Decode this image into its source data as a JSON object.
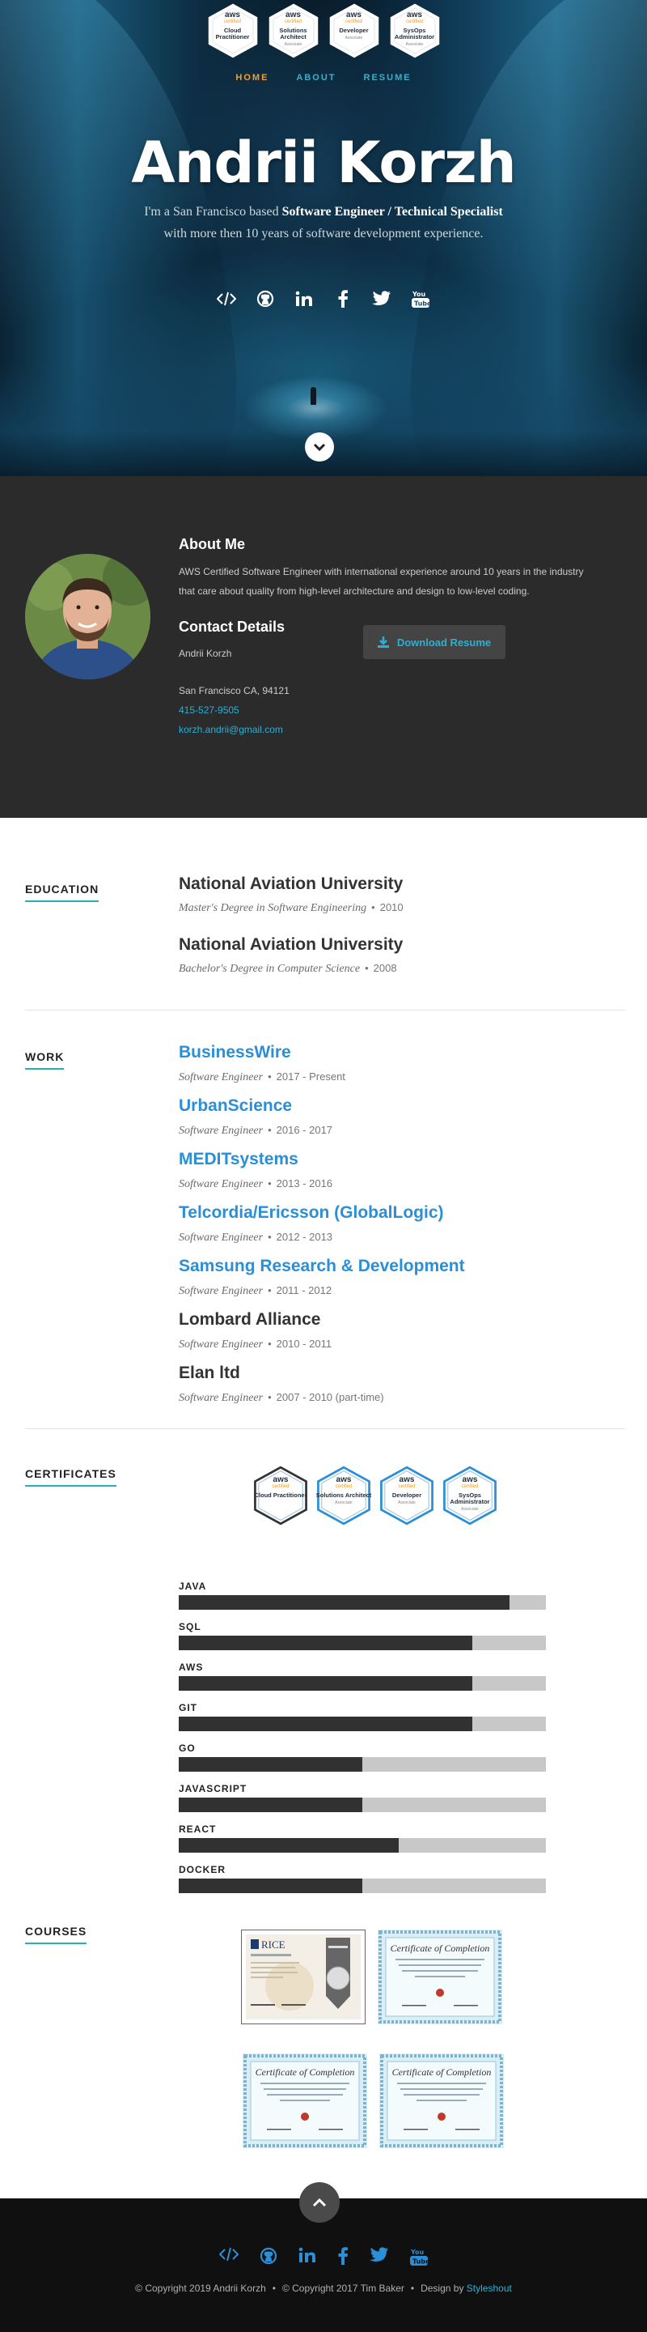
{
  "hero": {
    "badges": [
      {
        "brand": "aws",
        "sub": "certified",
        "title": "Cloud Practitioner",
        "level": ""
      },
      {
        "brand": "aws",
        "sub": "certified",
        "title": "Solutions Architect",
        "level": "Associate"
      },
      {
        "brand": "aws",
        "sub": "certified",
        "title": "Developer",
        "level": "Associate"
      },
      {
        "brand": "aws",
        "sub": "certified",
        "title": "SysOps Administrator",
        "level": "Associate"
      }
    ],
    "nav": [
      {
        "label": "HOME",
        "active": true
      },
      {
        "label": "ABOUT",
        "active": false
      },
      {
        "label": "RESUME",
        "active": false
      }
    ],
    "name": "Andrii Korzh",
    "intro_prefix": "I'm a San Francisco based ",
    "intro_role": "Software Engineer / Technical Specialist",
    "intro_suffix": " with more then 10 years of software development experience.",
    "social_icons": [
      "code-icon",
      "github-icon",
      "linkedin-icon",
      "facebook-icon",
      "twitter-icon",
      "youtube-icon"
    ]
  },
  "about": {
    "heading": "About Me",
    "bio": "AWS Certified Software Engineer with international experience around 10 years in the industry that care about quality from high-level architecture and design to low-level coding.",
    "contact_heading": "Contact Details",
    "contact_name": "Andrii Korzh",
    "contact_city": "San Francisco CA, 94121",
    "contact_phone": "415-527-9505",
    "contact_email": "korzh.andrii@gmail.com",
    "download_label": "Download Resume"
  },
  "education": {
    "label": "EDUCATION",
    "items": [
      {
        "school": "National Aviation University",
        "degree": "Master's Degree in Software Engineering",
        "year": "2010"
      },
      {
        "school": "National Aviation University",
        "degree": "Bachelor's Degree in Computer Science",
        "year": "2008"
      }
    ]
  },
  "work": {
    "label": "WORK",
    "items": [
      {
        "company": "BusinessWire",
        "role": "Software Engineer",
        "period": "2017 - Present",
        "linked": true
      },
      {
        "company": "UrbanScience",
        "role": "Software Engineer",
        "period": "2016 - 2017",
        "linked": true
      },
      {
        "company": "MEDITsystems",
        "role": "Software Engineer",
        "period": "2013 - 2016",
        "linked": true
      },
      {
        "company": "Telcordia/Ericsson (GlobalLogic)",
        "role": "Software Engineer",
        "period": "2012 - 2013",
        "linked": true
      },
      {
        "company": "Samsung Research & Development",
        "role": "Software Engineer",
        "period": "2011 - 2012",
        "linked": true
      },
      {
        "company": "Lombard Alliance",
        "role": "Software Engineer",
        "period": "2010 - 2011",
        "linked": false
      },
      {
        "company": "Elan ltd",
        "role": "Software Engineer",
        "period": "2007 - 2010 (part-time)",
        "linked": false
      }
    ]
  },
  "certificates": {
    "label": "CERTIFICATES"
  },
  "skills": [
    {
      "name": "JAVA",
      "level": 0.9
    },
    {
      "name": "SQL",
      "level": 0.8
    },
    {
      "name": "AWS",
      "level": 0.8
    },
    {
      "name": "GIT",
      "level": 0.8
    },
    {
      "name": "GO",
      "level": 0.5
    },
    {
      "name": "JAVASCRIPT",
      "level": 0.5
    },
    {
      "name": "REACT",
      "level": 0.6
    },
    {
      "name": "DOCKER",
      "level": 0.5
    }
  ],
  "courses": {
    "label": "COURSES",
    "items": [
      {
        "kind": "rice",
        "issuer": "RICE"
      },
      {
        "kind": "cert",
        "title": "Certificate of Completion"
      },
      {
        "kind": "cert",
        "title": "Certificate of Completion"
      },
      {
        "kind": "cert",
        "title": "Certificate of Completion"
      }
    ]
  },
  "footer": {
    "copy_1": "© Copyright 2019 Andrii Korzh",
    "copy_2": "© Copyright 2017 Tim Baker",
    "design_prefix": "Design by ",
    "design_link": "Styleshout"
  },
  "colors": {
    "accent": "#2ab0d5",
    "nav_active": "#f0a030",
    "link_blue": "#2a8fd6",
    "about_bg": "#2b2b2b",
    "footer_bg": "#101010",
    "skill_fill": "#313131",
    "skill_track": "#c8c8c8"
  }
}
